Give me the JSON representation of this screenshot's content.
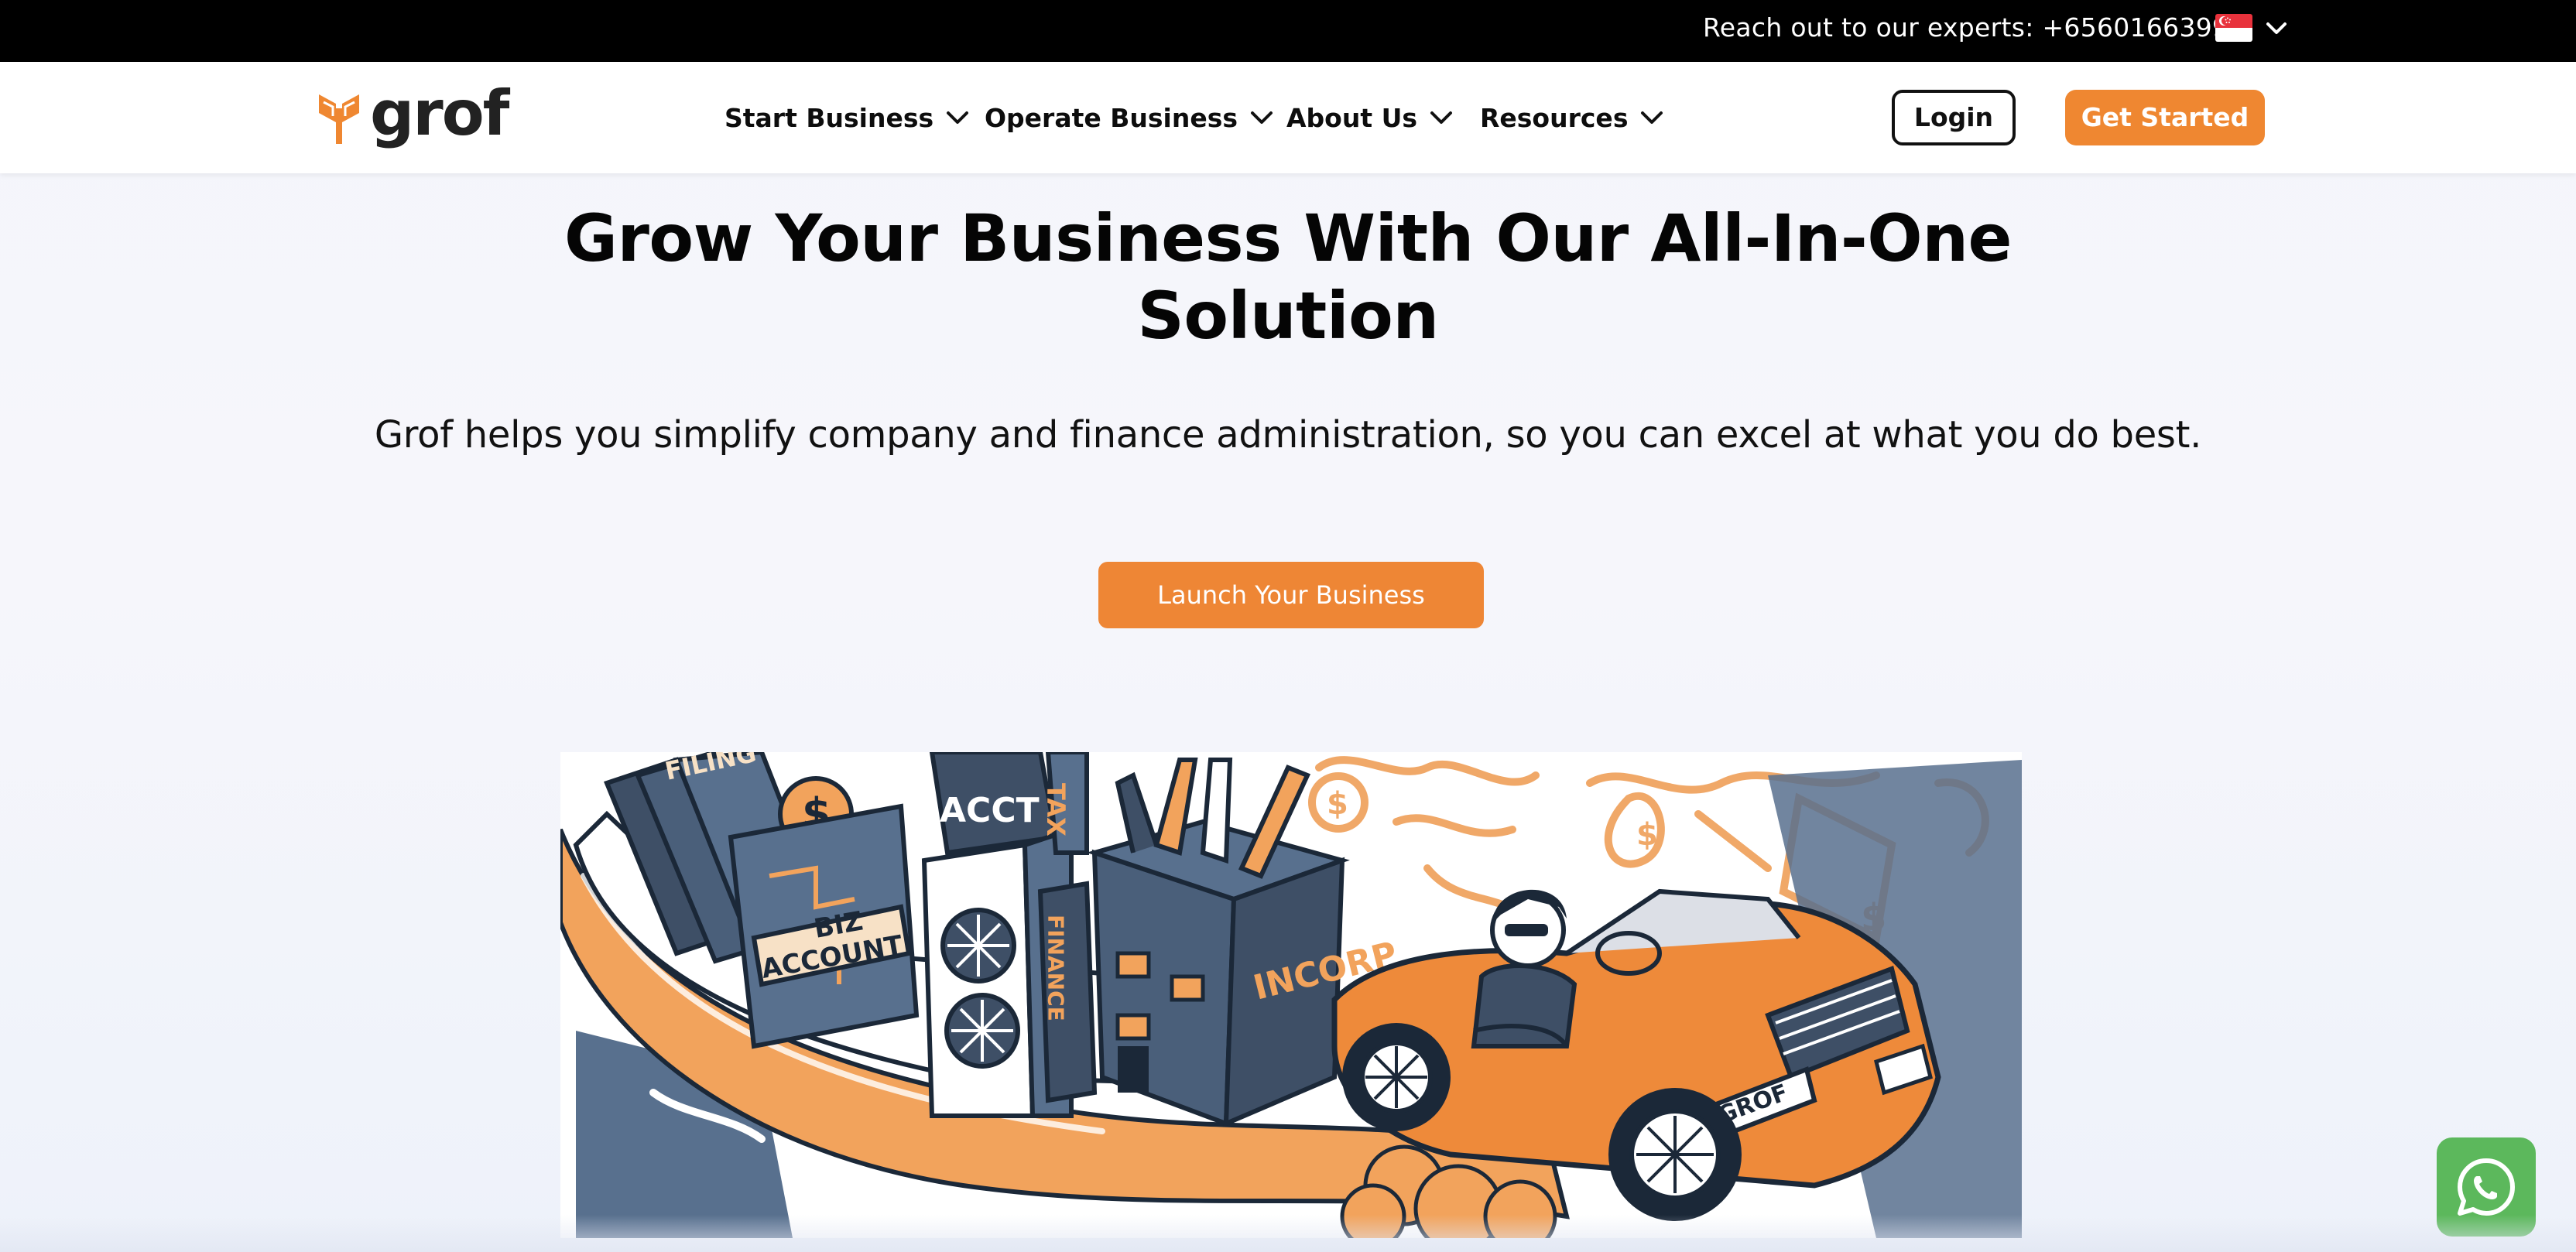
{
  "topbar": {
    "contact_text": "Reach out to our experts: +6560166399",
    "flag_icon": "singapore-flag-icon",
    "chevron_icon": "chevron-down-icon"
  },
  "brand": {
    "name": "grof",
    "accent_color": "#ef8731",
    "logo_icon": "grof-leaf-logo-icon"
  },
  "nav": {
    "items": [
      {
        "label": "Start Business"
      },
      {
        "label": "Operate Business"
      },
      {
        "label": "About Us"
      },
      {
        "label": "Resources"
      }
    ],
    "login_label": "Login",
    "get_started_label": "Get Started"
  },
  "hero": {
    "title_line1": "Grow Your Business With Our All-In-One",
    "title_line2": "Solution",
    "subtitle": "Grof helps you simplify company and finance administration, so you can excel at what you do best.",
    "cta_label": "Launch Your Business"
  },
  "illustration": {
    "labels": {
      "filing": "FILING",
      "biz": "BIZ",
      "account": "ACCOUNT",
      "acct": "ACCT",
      "tax": "TAX",
      "finance": "FINANCE",
      "incorp": "INCORP",
      "plate": "GROF",
      "dollar": "$"
    }
  },
  "whatsapp": {
    "icon": "whatsapp-icon",
    "color": "#5cb85c"
  }
}
